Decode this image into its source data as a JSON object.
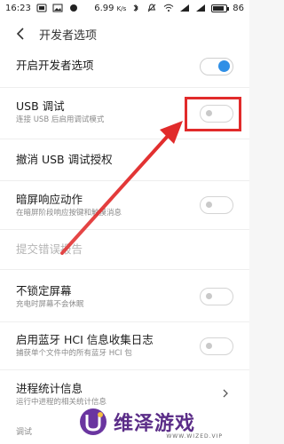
{
  "status_bar": {
    "time": "16:23",
    "speed": "6.99",
    "speed_unit": "K/s",
    "battery": "86"
  },
  "header": {
    "title": "开发者选项"
  },
  "settings": [
    {
      "title": "开启开发者选项",
      "subtitle": "",
      "control": "toggle",
      "state": "on"
    },
    {
      "title": "USB 调试",
      "subtitle": "连接 USB 后启用调试模式",
      "control": "toggle",
      "state": "off"
    },
    {
      "title": "撤消 USB 调试授权",
      "subtitle": "",
      "control": "none"
    },
    {
      "title": "暗屏响应动作",
      "subtitle": "在暗屏阶段响应按键和触摸消息",
      "control": "toggle",
      "state": "off"
    },
    {
      "title": "提交错误报告",
      "subtitle": "",
      "control": "none",
      "disabled": true
    },
    {
      "title": "不锁定屏幕",
      "subtitle": "充电时屏幕不会休眠",
      "control": "toggle",
      "state": "off"
    },
    {
      "title": "启用蓝牙 HCI 信息收集日志",
      "subtitle": "捕获单个文件中的所有蓝牙 HCI 包",
      "control": "toggle",
      "state": "off"
    },
    {
      "title": "进程统计信息",
      "subtitle": "运行中进程的相关统计信息",
      "control": "chevron"
    },
    {
      "title": "调试",
      "subtitle": "",
      "control": "none",
      "section": true
    }
  ],
  "watermark": {
    "text": "维泽游戏",
    "sub": "WWW.WIZED.VIP"
  },
  "colors": {
    "accent": "#2f8fe6",
    "highlight": "#e12b2b",
    "watermark": "#5b2d88"
  }
}
